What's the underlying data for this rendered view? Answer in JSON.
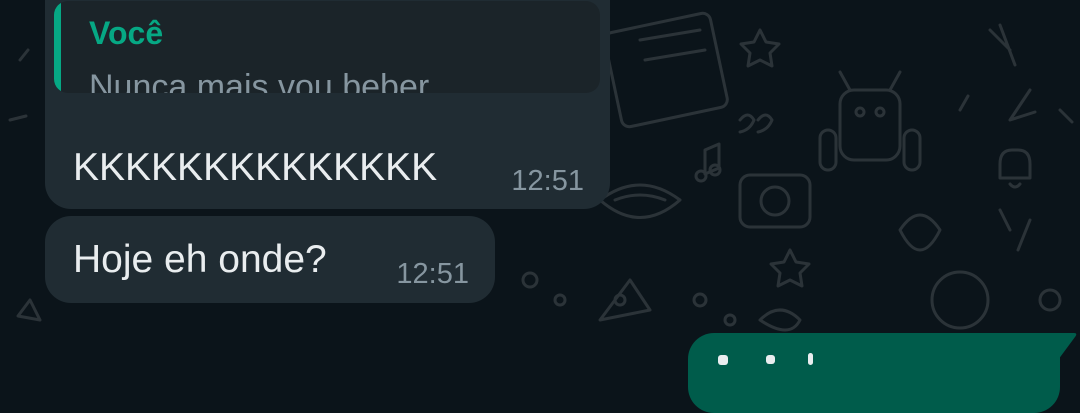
{
  "chat": {
    "messages": [
      {
        "direction": "incoming",
        "reply_to": {
          "author": "Você",
          "text": "Nunca mais vou beber"
        },
        "text": "KKKKKKKKKKKKKK",
        "time": "12:51"
      },
      {
        "direction": "incoming",
        "text": "Hoje eh onde?",
        "time": "12:51"
      },
      {
        "direction": "outgoing",
        "text": "",
        "time": ""
      }
    ]
  },
  "colors": {
    "background": "#0b141a",
    "incoming_bubble": "#202c33",
    "outgoing_bubble": "#005c4b",
    "quote_accent": "#06a884",
    "text_primary": "#e9edef",
    "text_secondary": "#8696a0"
  }
}
